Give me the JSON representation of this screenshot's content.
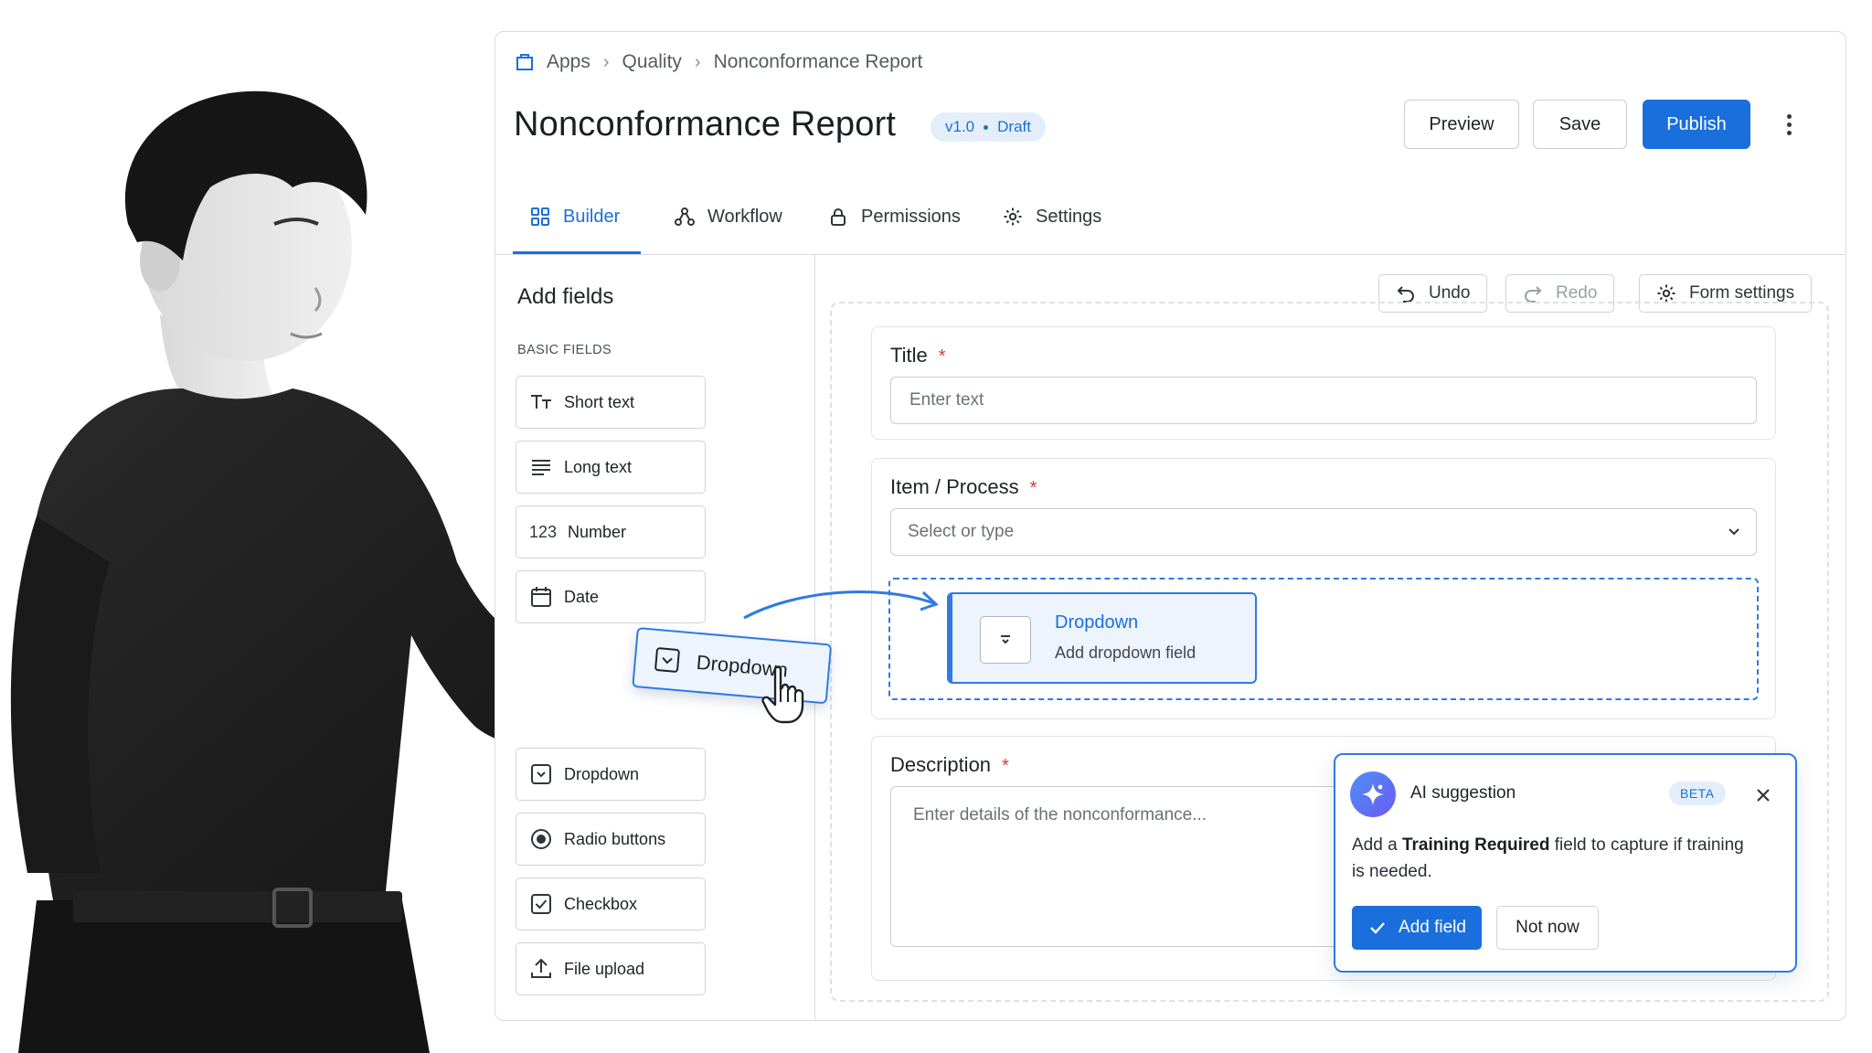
{
  "breadcrumb": {
    "items": [
      "Apps",
      "Quality",
      "Nonconformance Report"
    ],
    "icon": "apps-box-icon"
  },
  "header": {
    "title": "Nonconformance Report",
    "version": "v1.0",
    "status": "Draft",
    "buttons": {
      "preview": "Preview",
      "save": "Save",
      "publish": "Publish"
    }
  },
  "tabs": [
    {
      "label": "Builder",
      "icon": "grid-icon",
      "active": true
    },
    {
      "label": "Workflow",
      "icon": "workflow-icon",
      "active": false
    },
    {
      "label": "Permissions",
      "icon": "lock-icon",
      "active": false
    },
    {
      "label": "Settings",
      "icon": "gear-icon",
      "active": false
    }
  ],
  "left_panel": {
    "title": "Add fields",
    "section": "BASIC FIELDS",
    "fields": [
      {
        "label": "Short text",
        "icon": "short-text-icon"
      },
      {
        "label": "Long text",
        "icon": "long-text-icon"
      },
      {
        "label": "Number",
        "icon": "number-icon",
        "glyph": "123"
      },
      {
        "label": "Date",
        "icon": "calendar-icon"
      },
      {
        "label": "Dropdown",
        "icon": "dropdown-icon"
      },
      {
        "label": "Radio buttons",
        "icon": "radio-icon"
      },
      {
        "label": "Checkbox",
        "icon": "checkbox-icon"
      },
      {
        "label": "File upload",
        "icon": "upload-icon"
      }
    ]
  },
  "toolbar": {
    "undo": "Undo",
    "redo": "Redo",
    "form_settings": "Form settings"
  },
  "form": {
    "title_field": {
      "label": "Title",
      "placeholder": "Enter text",
      "required": "*"
    },
    "item_field": {
      "label": "Item / Process",
      "placeholder": "Select or type",
      "required": "*"
    },
    "drop_preview": {
      "title": "Dropdown",
      "subtitle": "Add dropdown field"
    },
    "description_field": {
      "label": "Description",
      "placeholder": "Enter details of the nonconformance...",
      "required": "*"
    }
  },
  "drag": {
    "label": "Dropdown"
  },
  "ai_suggestion": {
    "title": "AI suggestion",
    "badge": "BETA",
    "text_prefix": "Add a ",
    "text_bold": "Training Required",
    "text_suffix": " field to capture if training is needed.",
    "add_button": "Add field",
    "dismiss_button": "Not now"
  },
  "colors": {
    "accent": "#1a6fdc",
    "required": "#d83a3a",
    "badge_bg": "#e4eefb"
  }
}
